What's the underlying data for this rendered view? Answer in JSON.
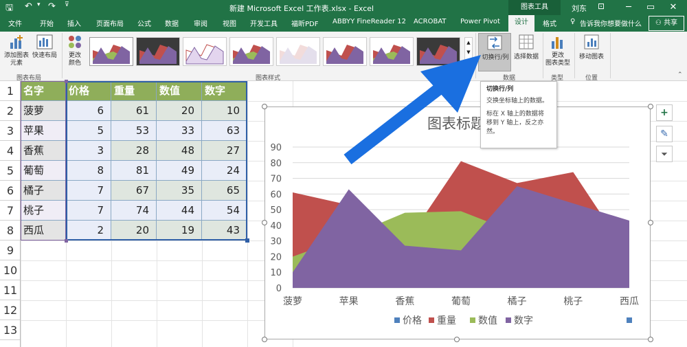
{
  "app": {
    "window_title": "新建 Microsoft Excel 工作表.xlsx  -  Excel",
    "context_tab_group": "图表工具",
    "user_name": "刘东",
    "restore_glyph": "▭"
  },
  "ribbon_tabs": [
    "文件",
    "开始",
    "插入",
    "页面布局",
    "公式",
    "数据",
    "审阅",
    "视图",
    "开发工具",
    "福昕PDF",
    "ABBYY FineReader 12",
    "ACROBAT",
    "Power Pivot",
    "设计",
    "格式"
  ],
  "active_tab": "设计",
  "tell_me": "告诉我你想要做什么",
  "share": "共享",
  "ribbon": {
    "groups": {
      "chart_layout": "图表布局",
      "chart_styles": "图表样式",
      "data": "数据",
      "type": "类型",
      "location": "位置"
    },
    "buttons": {
      "add_element_line1": "添加图表",
      "add_element_line2": "元素",
      "quick_layout": "快速布局",
      "change_colors_line1": "更改",
      "change_colors_line2": "颜色",
      "switch_row_col": "切换行/列",
      "select_data": "选择数据",
      "change_type_line1": "更改",
      "change_type_line2": "图表类型",
      "move_chart": "移动图表"
    }
  },
  "tooltip": {
    "title": "切换行/列",
    "line1": "交换坐标轴上的数据。",
    "line2": "标在 X 轴上的数据将",
    "line3": "移到 Y 轴上，反之亦",
    "line4": "然。"
  },
  "sheet": {
    "row_numbers": [
      "1",
      "2",
      "3",
      "4",
      "5",
      "6",
      "7",
      "8",
      "9",
      "10",
      "11",
      "12",
      "13"
    ],
    "headers": [
      "名字",
      "价格",
      "重量",
      "数值",
      "数字"
    ],
    "rows": [
      {
        "name": "菠萝",
        "vals": [
          "6",
          "61",
          "20",
          "10"
        ]
      },
      {
        "name": "苹果",
        "vals": [
          "5",
          "53",
          "33",
          "63"
        ]
      },
      {
        "name": "香蕉",
        "vals": [
          "3",
          "28",
          "48",
          "27"
        ]
      },
      {
        "name": "葡萄",
        "vals": [
          "8",
          "81",
          "49",
          "24"
        ]
      },
      {
        "name": "橘子",
        "vals": [
          "7",
          "67",
          "35",
          "65"
        ]
      },
      {
        "name": "桃子",
        "vals": [
          "7",
          "74",
          "44",
          "54"
        ]
      },
      {
        "name": "西瓜",
        "vals": [
          "2",
          "20",
          "19",
          "43"
        ]
      }
    ]
  },
  "colors": {
    "excel_green": "#217346",
    "header_fill": "#8fae5a",
    "series_price": "#4f81bd",
    "series_weight": "#c0504d",
    "series_value": "#9bbb59",
    "series_number": "#8064a2",
    "arrow_blue": "#1a6fe0"
  },
  "chart_data": {
    "type": "area",
    "title": "图表标题",
    "categories": [
      "菠萝",
      "苹果",
      "香蕉",
      "葡萄",
      "橘子",
      "桃子",
      "西瓜"
    ],
    "ylim": [
      0,
      90
    ],
    "yticks": [
      0,
      10,
      20,
      30,
      40,
      50,
      60,
      70,
      80,
      90
    ],
    "grid": true,
    "legend_position": "bottom",
    "series": [
      {
        "name": "价格",
        "values": [
          6,
          5,
          3,
          8,
          7,
          7,
          2
        ]
      },
      {
        "name": "重量",
        "values": [
          61,
          53,
          28,
          81,
          67,
          74,
          20
        ]
      },
      {
        "name": "数值",
        "values": [
          20,
          33,
          48,
          49,
          35,
          44,
          19
        ]
      },
      {
        "name": "数字",
        "values": [
          10,
          63,
          27,
          24,
          65,
          54,
          43
        ]
      }
    ]
  }
}
